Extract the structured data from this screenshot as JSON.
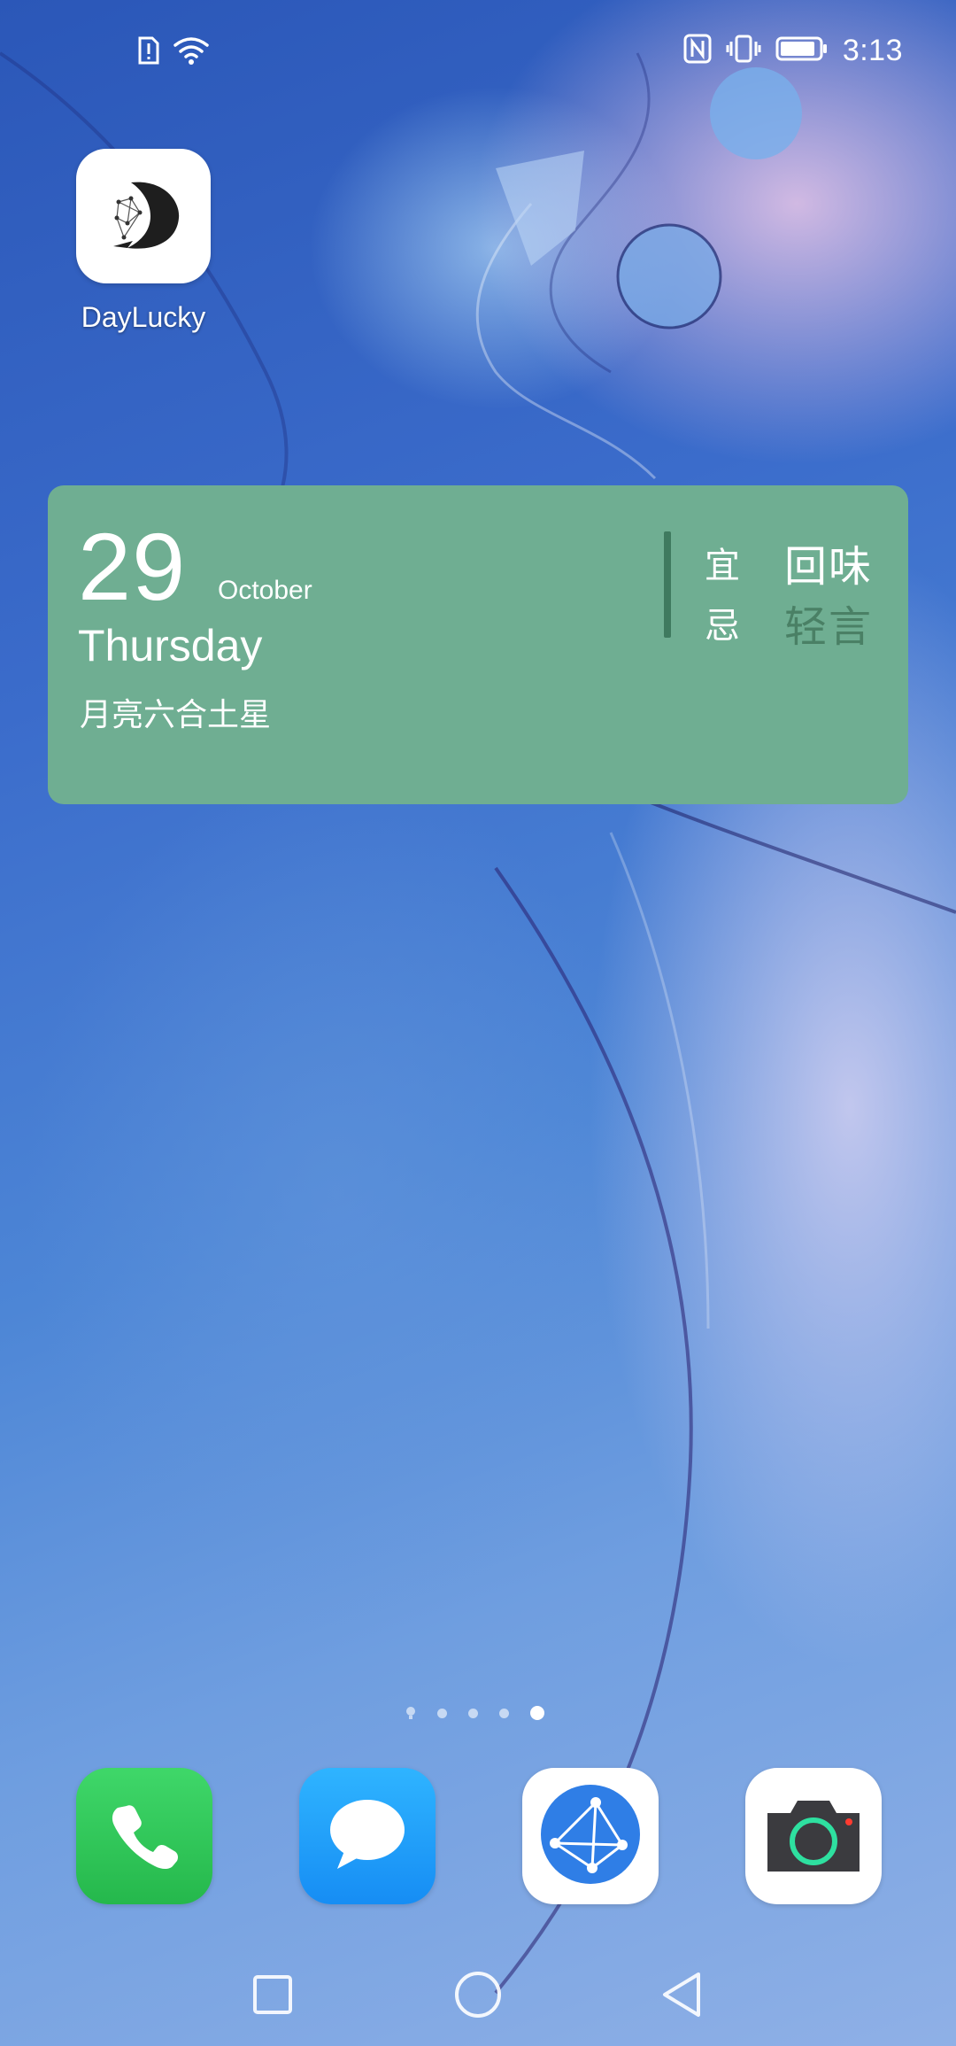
{
  "status_bar": {
    "time": "3:13",
    "left_icons": [
      "sim-alert-icon",
      "wifi-icon"
    ],
    "right_icons": [
      "nfc-icon",
      "vibrate-icon",
      "battery-icon"
    ],
    "battery_level": 0.9
  },
  "home": {
    "apps": [
      {
        "label": "DayLucky",
        "icon": "daylucky-logo-icon"
      }
    ]
  },
  "widget": {
    "day": "29",
    "month": "October",
    "weekday": "Thursday",
    "astro": "月亮六合土星",
    "yi_label": "宜",
    "yi_value": "回味",
    "ji_label": "忌",
    "ji_value": "轻言",
    "colors": {
      "background": "#6fae92",
      "divider": "#3f7a5f",
      "bad_text": "#4a8065"
    }
  },
  "page_indicator": {
    "pages": 5,
    "current": 5
  },
  "dock": {
    "apps": [
      {
        "name": "Phone",
        "icon": "phone-icon"
      },
      {
        "name": "Messages",
        "icon": "message-bubble-icon"
      },
      {
        "name": "Browser",
        "icon": "browser-globe-icon"
      },
      {
        "name": "Camera",
        "icon": "camera-icon"
      }
    ]
  },
  "nav": {
    "buttons": [
      "recents-square-icon",
      "home-circle-icon",
      "back-triangle-icon"
    ]
  }
}
